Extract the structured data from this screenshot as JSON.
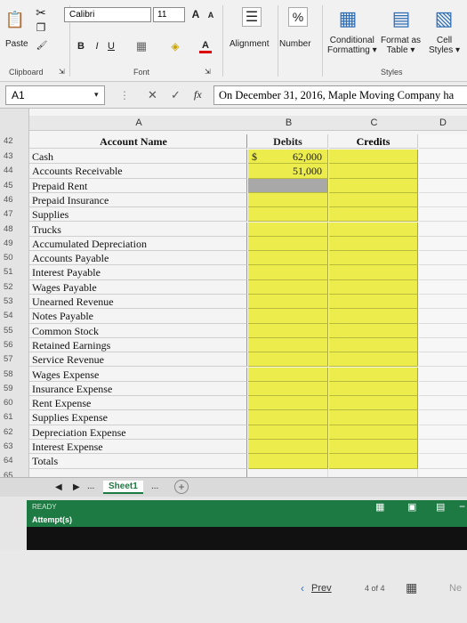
{
  "ribbon": {
    "paste_label": "Paste",
    "font_name": "Calibri",
    "font_size": "11",
    "bold": "B",
    "italic": "I",
    "underline": "U",
    "grow_font": "A",
    "shrink_font": "A",
    "alignment_label": "Alignment",
    "number_label": "Number",
    "number_symbol": "%",
    "conditional_formatting_line1": "Conditional",
    "conditional_formatting_line2": "Formatting",
    "format_as_table_line1": "Format as",
    "format_as_table_line2": "Table",
    "cell_styles_line1": "Cell",
    "cell_styles_line2": "Styles",
    "groups": {
      "clipboard": "Clipboard",
      "font": "Font",
      "styles": "Styles"
    }
  },
  "formula_bar": {
    "name_box": "A1",
    "cancel": "✕",
    "enter": "✓",
    "fx": "fx",
    "content": "On December 31, 2016, Maple Moving Company ha"
  },
  "columns": {
    "a": "A",
    "b": "B",
    "c": "C",
    "d": "D"
  },
  "headers": {
    "account_name": "Account Name",
    "debits": "Debits",
    "credits": "Credits",
    "row_num": "42"
  },
  "rows": [
    {
      "num": "43",
      "account": "Cash",
      "debit_prefix": "$",
      "debit": "62,000"
    },
    {
      "num": "44",
      "account": "Accounts Receivable",
      "debit_prefix": "",
      "debit": "51,000"
    },
    {
      "num": "45",
      "account": "Prepaid Rent",
      "debit_prefix": "",
      "debit": ""
    },
    {
      "num": "46",
      "account": "Prepaid Insurance",
      "debit_prefix": "",
      "debit": ""
    },
    {
      "num": "47",
      "account": "Supplies",
      "debit_prefix": "",
      "debit": ""
    },
    {
      "num": "48",
      "account": "Trucks",
      "debit_prefix": "",
      "debit": ""
    },
    {
      "num": "49",
      "account": "Accumulated Depreciation",
      "debit_prefix": "",
      "debit": ""
    },
    {
      "num": "50",
      "account": "Accounts Payable",
      "debit_prefix": "",
      "debit": ""
    },
    {
      "num": "51",
      "account": "Interest Payable",
      "debit_prefix": "",
      "debit": ""
    },
    {
      "num": "52",
      "account": "Wages Payable",
      "debit_prefix": "",
      "debit": ""
    },
    {
      "num": "53",
      "account": "Unearned Revenue",
      "debit_prefix": "",
      "debit": ""
    },
    {
      "num": "54",
      "account": "Notes Payable",
      "debit_prefix": "",
      "debit": ""
    },
    {
      "num": "55",
      "account": "Common Stock",
      "debit_prefix": "",
      "debit": ""
    },
    {
      "num": "56",
      "account": "Retained Earnings",
      "debit_prefix": "",
      "debit": ""
    },
    {
      "num": "57",
      "account": "Service Revenue",
      "debit_prefix": "",
      "debit": ""
    },
    {
      "num": "58",
      "account": "Wages Expense",
      "debit_prefix": "",
      "debit": ""
    },
    {
      "num": "59",
      "account": "Insurance Expense",
      "debit_prefix": "",
      "debit": ""
    },
    {
      "num": "60",
      "account": "Rent Expense",
      "debit_prefix": "",
      "debit": ""
    },
    {
      "num": "61",
      "account": "Supplies Expense",
      "debit_prefix": "",
      "debit": ""
    },
    {
      "num": "62",
      "account": "Depreciation Expense",
      "debit_prefix": "",
      "debit": ""
    },
    {
      "num": "63",
      "account": "Interest Expense",
      "debit_prefix": "",
      "debit": ""
    },
    {
      "num": "64",
      "account": "Totals",
      "debit_prefix": "",
      "debit": ""
    },
    {
      "num": "65",
      "account": "",
      "debit_prefix": "",
      "debit": ""
    }
  ],
  "sheet_tabs": {
    "ellipsis": "...",
    "active": "Sheet1",
    "ellipsis_right": "...",
    "add": "+"
  },
  "status": {
    "ready": "READY",
    "attempts": "Attempt(s)"
  },
  "navigation": {
    "prev": "Prev",
    "page": "4 of 4",
    "next": "Ne"
  },
  "colors": {
    "answer_cell": "#ecec4c",
    "status_green": "#1e7a43"
  }
}
